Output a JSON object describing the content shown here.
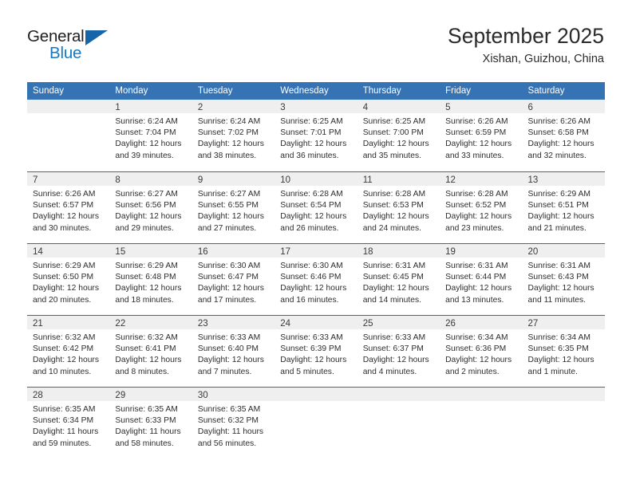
{
  "logo": {
    "word_top": "General",
    "word_bottom": "Blue",
    "triangle_color": "#1565a8",
    "blue_color": "#1479c4"
  },
  "header": {
    "title": "September 2025",
    "subtitle": "Xishan, Guizhou, China"
  },
  "theme": {
    "header_blue": "#3573b4",
    "row_divider_blue": "#2e6da9",
    "daynum_band": "#efefef"
  },
  "weekdays": [
    "Sunday",
    "Monday",
    "Tuesday",
    "Wednesday",
    "Thursday",
    "Friday",
    "Saturday"
  ],
  "weeks": [
    [
      {
        "day": "",
        "lines": []
      },
      {
        "day": "1",
        "lines": [
          "Sunrise: 6:24 AM",
          "Sunset: 7:04 PM",
          "Daylight: 12 hours",
          "and 39 minutes."
        ]
      },
      {
        "day": "2",
        "lines": [
          "Sunrise: 6:24 AM",
          "Sunset: 7:02 PM",
          "Daylight: 12 hours",
          "and 38 minutes."
        ]
      },
      {
        "day": "3",
        "lines": [
          "Sunrise: 6:25 AM",
          "Sunset: 7:01 PM",
          "Daylight: 12 hours",
          "and 36 minutes."
        ]
      },
      {
        "day": "4",
        "lines": [
          "Sunrise: 6:25 AM",
          "Sunset: 7:00 PM",
          "Daylight: 12 hours",
          "and 35 minutes."
        ]
      },
      {
        "day": "5",
        "lines": [
          "Sunrise: 6:26 AM",
          "Sunset: 6:59 PM",
          "Daylight: 12 hours",
          "and 33 minutes."
        ]
      },
      {
        "day": "6",
        "lines": [
          "Sunrise: 6:26 AM",
          "Sunset: 6:58 PM",
          "Daylight: 12 hours",
          "and 32 minutes."
        ]
      }
    ],
    [
      {
        "day": "7",
        "lines": [
          "Sunrise: 6:26 AM",
          "Sunset: 6:57 PM",
          "Daylight: 12 hours",
          "and 30 minutes."
        ]
      },
      {
        "day": "8",
        "lines": [
          "Sunrise: 6:27 AM",
          "Sunset: 6:56 PM",
          "Daylight: 12 hours",
          "and 29 minutes."
        ]
      },
      {
        "day": "9",
        "lines": [
          "Sunrise: 6:27 AM",
          "Sunset: 6:55 PM",
          "Daylight: 12 hours",
          "and 27 minutes."
        ]
      },
      {
        "day": "10",
        "lines": [
          "Sunrise: 6:28 AM",
          "Sunset: 6:54 PM",
          "Daylight: 12 hours",
          "and 26 minutes."
        ]
      },
      {
        "day": "11",
        "lines": [
          "Sunrise: 6:28 AM",
          "Sunset: 6:53 PM",
          "Daylight: 12 hours",
          "and 24 minutes."
        ]
      },
      {
        "day": "12",
        "lines": [
          "Sunrise: 6:28 AM",
          "Sunset: 6:52 PM",
          "Daylight: 12 hours",
          "and 23 minutes."
        ]
      },
      {
        "day": "13",
        "lines": [
          "Sunrise: 6:29 AM",
          "Sunset: 6:51 PM",
          "Daylight: 12 hours",
          "and 21 minutes."
        ]
      }
    ],
    [
      {
        "day": "14",
        "lines": [
          "Sunrise: 6:29 AM",
          "Sunset: 6:50 PM",
          "Daylight: 12 hours",
          "and 20 minutes."
        ]
      },
      {
        "day": "15",
        "lines": [
          "Sunrise: 6:29 AM",
          "Sunset: 6:48 PM",
          "Daylight: 12 hours",
          "and 18 minutes."
        ]
      },
      {
        "day": "16",
        "lines": [
          "Sunrise: 6:30 AM",
          "Sunset: 6:47 PM",
          "Daylight: 12 hours",
          "and 17 minutes."
        ]
      },
      {
        "day": "17",
        "lines": [
          "Sunrise: 6:30 AM",
          "Sunset: 6:46 PM",
          "Daylight: 12 hours",
          "and 16 minutes."
        ]
      },
      {
        "day": "18",
        "lines": [
          "Sunrise: 6:31 AM",
          "Sunset: 6:45 PM",
          "Daylight: 12 hours",
          "and 14 minutes."
        ]
      },
      {
        "day": "19",
        "lines": [
          "Sunrise: 6:31 AM",
          "Sunset: 6:44 PM",
          "Daylight: 12 hours",
          "and 13 minutes."
        ]
      },
      {
        "day": "20",
        "lines": [
          "Sunrise: 6:31 AM",
          "Sunset: 6:43 PM",
          "Daylight: 12 hours",
          "and 11 minutes."
        ]
      }
    ],
    [
      {
        "day": "21",
        "lines": [
          "Sunrise: 6:32 AM",
          "Sunset: 6:42 PM",
          "Daylight: 12 hours",
          "and 10 minutes."
        ]
      },
      {
        "day": "22",
        "lines": [
          "Sunrise: 6:32 AM",
          "Sunset: 6:41 PM",
          "Daylight: 12 hours",
          "and 8 minutes."
        ]
      },
      {
        "day": "23",
        "lines": [
          "Sunrise: 6:33 AM",
          "Sunset: 6:40 PM",
          "Daylight: 12 hours",
          "and 7 minutes."
        ]
      },
      {
        "day": "24",
        "lines": [
          "Sunrise: 6:33 AM",
          "Sunset: 6:39 PM",
          "Daylight: 12 hours",
          "and 5 minutes."
        ]
      },
      {
        "day": "25",
        "lines": [
          "Sunrise: 6:33 AM",
          "Sunset: 6:37 PM",
          "Daylight: 12 hours",
          "and 4 minutes."
        ]
      },
      {
        "day": "26",
        "lines": [
          "Sunrise: 6:34 AM",
          "Sunset: 6:36 PM",
          "Daylight: 12 hours",
          "and 2 minutes."
        ]
      },
      {
        "day": "27",
        "lines": [
          "Sunrise: 6:34 AM",
          "Sunset: 6:35 PM",
          "Daylight: 12 hours",
          "and 1 minute."
        ]
      }
    ],
    [
      {
        "day": "28",
        "lines": [
          "Sunrise: 6:35 AM",
          "Sunset: 6:34 PM",
          "Daylight: 11 hours",
          "and 59 minutes."
        ]
      },
      {
        "day": "29",
        "lines": [
          "Sunrise: 6:35 AM",
          "Sunset: 6:33 PM",
          "Daylight: 11 hours",
          "and 58 minutes."
        ]
      },
      {
        "day": "30",
        "lines": [
          "Sunrise: 6:35 AM",
          "Sunset: 6:32 PM",
          "Daylight: 11 hours",
          "and 56 minutes."
        ]
      },
      {
        "day": "",
        "lines": []
      },
      {
        "day": "",
        "lines": []
      },
      {
        "day": "",
        "lines": []
      },
      {
        "day": "",
        "lines": []
      }
    ]
  ]
}
